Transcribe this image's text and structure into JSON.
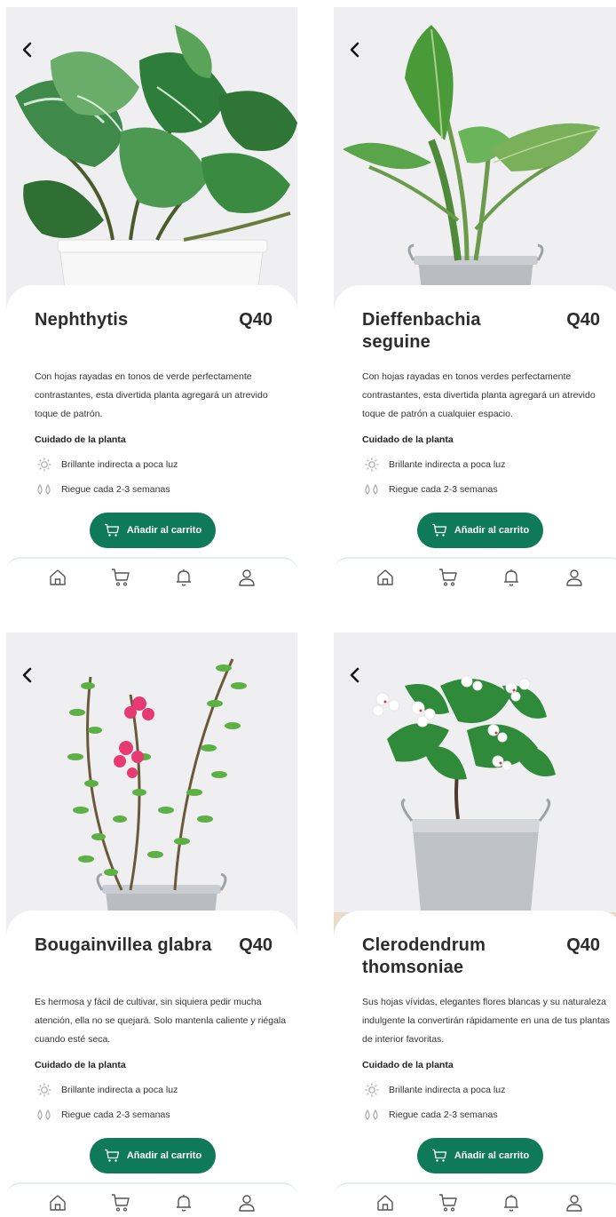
{
  "screens": [
    {
      "title": "Nephthytis",
      "price": "Q40",
      "description": "Con hojas rayadas en tonos de verde perfectamente contrastantes, esta divertida planta agregará un atrevido toque de patrón.",
      "care_title": "Cuidado de la planta",
      "care_light": "Brillante indirecta a poca luz",
      "care_water": "Riegue cada 2-3 semanas",
      "button_label": "Añadir al carrito"
    },
    {
      "title": "Dieffenbachia seguine",
      "price": "Q40",
      "description": "Con hojas rayadas en tonos verdes perfectamente contrastantes, esta divertida planta agregará un atrevido toque de patrón a cualquier espacio.",
      "care_title": "Cuidado de la planta",
      "care_light": "Brillante indirecta a poca luz",
      "care_water": "Riegue cada 2-3 semanas",
      "button_label": "Añadir al carrito"
    },
    {
      "title": "Bougainvillea glabra",
      "price": "Q40",
      "description": "Es hermosa y fácil de cultivar, sin siquiera pedir mucha atención, ella no se quejará. Solo mantenla caliente y riégala cuando esté seca.",
      "care_title": "Cuidado de la planta",
      "care_light": "Brillante indirecta a poca luz",
      "care_water": "Riegue cada 2-3 semanas",
      "button_label": "Añadir al carrito"
    },
    {
      "title": "Clerodendrum thomsoniae",
      "price": "Q40",
      "description": "Sus hojas vívidas, elegantes flores blancas y su naturaleza indulgente la convertirán rápidamente en una de tus plantas de interior favoritas.",
      "care_title": "Cuidado de la planta",
      "care_light": "Brillante indirecta a poca luz",
      "care_water": "Riegue cada 2-3 semanas",
      "button_label": "Añadir al carrito"
    }
  ],
  "icons": {
    "back": "chevron-left-icon",
    "sun": "sun-icon",
    "water": "water-drops-icon",
    "cart": "cart-icon",
    "nav": [
      "home-icon",
      "cart-icon",
      "bell-icon",
      "user-icon"
    ]
  },
  "colors": {
    "accent": "#0f7a57",
    "nav_border": "#e2efe9",
    "photo_bg": "#ededf0"
  }
}
